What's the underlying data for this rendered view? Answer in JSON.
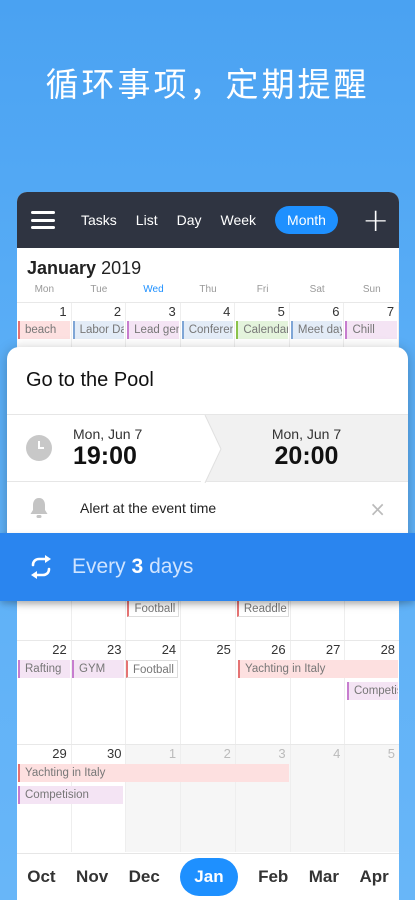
{
  "headline": "循环事项，定期提醒",
  "toolbar": {
    "tabs": [
      "Tasks",
      "List",
      "Day",
      "Week",
      "Month"
    ],
    "active_tab": "Month"
  },
  "calendar": {
    "month": "January",
    "year": "2019",
    "weekdays": [
      "Mon",
      "Tue",
      "Wed",
      "Thu",
      "Fri",
      "Sat",
      "Sun"
    ],
    "week1": {
      "days": [
        "1",
        "2",
        "3",
        "4",
        "5",
        "6",
        "7"
      ],
      "events": [
        "beach",
        "Labor Day",
        "Lead gen",
        "Conference",
        "Calendar",
        "Meet day",
        "Chill"
      ]
    },
    "week3_events": [
      "Football",
      "Readdle"
    ],
    "week4": {
      "days": [
        "22",
        "23",
        "24",
        "25",
        "26",
        "27",
        "28"
      ],
      "events": [
        "Rafting",
        "GYM",
        "Football",
        "Yachting in Italy",
        "Competision"
      ]
    },
    "week5": {
      "days": [
        "29",
        "30",
        "1",
        "2",
        "3",
        "4",
        "5"
      ],
      "events": [
        "Yachting in Italy",
        "Competision"
      ]
    }
  },
  "popup": {
    "title": "Go to the Pool",
    "start_day": "Mon, Jun 7",
    "start_time": "19:00",
    "end_day": "Mon, Jun 7",
    "end_time": "20:00",
    "alert": "Alert at the event time",
    "close": "×"
  },
  "repeat": {
    "prefix": "Every",
    "count": "3",
    "suffix": "days"
  },
  "months": [
    "Oct",
    "Nov",
    "Dec",
    "Jan",
    "Feb",
    "Mar",
    "Apr"
  ],
  "colors": {
    "accent": "#1e90ff",
    "topbar": "#2f3441",
    "repeat_bar": "#2a85ef"
  }
}
